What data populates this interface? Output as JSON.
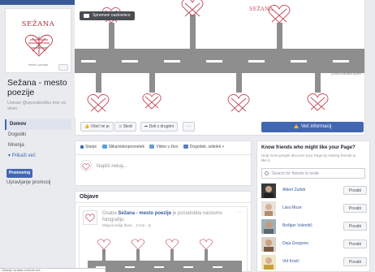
{
  "page": {
    "name": "Sežana - mesto poezije",
    "handle": "Ustvari @uporabniško ime za stran",
    "logo_text": "SEŽANA",
    "logo_sub": "mesto poezije"
  },
  "nav": {
    "items": [
      "Domov",
      "Dogodki",
      "Mnenja"
    ],
    "more": "Prikaži več",
    "promote": "Promoviraj",
    "manage_promos": "Upravljanje promocij"
  },
  "cover": {
    "change_button": "Spremeni naslovnico",
    "top_text": "SEŽANA",
    "credit": "podcrtanka.splet"
  },
  "actions": {
    "like": "Všeč mi je",
    "follow": "Sledi",
    "share": "Deli z drugimi",
    "more": "···",
    "learn_more": "Več informacij"
  },
  "composer": {
    "tabs": [
      "Stanje",
      "Slika/videoposnetek",
      "Video v živo",
      "Dogodek, izdelek +"
    ],
    "placeholder": "Napiši nekaj..."
  },
  "posts": {
    "heading": "Objave",
    "items": [
      {
        "author_prefix": "Osaba ",
        "author_bold": "Sežana - mesto poezije",
        "author_suffix": " je posodobila naslovno fotografijo.",
        "meta": "Objavil Jelija Živec · 2 min · ◎",
        "more": "···"
      }
    ]
  },
  "friends": {
    "title": "Know friends who might like your Page?",
    "subtitle": "Help more people discover your Page by inviting friends to like it.",
    "search_placeholder": "Search for friends to invite",
    "invite_label": "Povabi",
    "list": [
      {
        "name": "Albert Zudek"
      },
      {
        "name": "Lara Moze"
      },
      {
        "name": "Boštjan Volenšič"
      },
      {
        "name": "Deja Gregorec"
      },
      {
        "name": "Vid Kosič"
      }
    ]
  },
  "status_bar": "Čakanje na static.xx.fbcdn.net...",
  "colors": {
    "facebook_blue": "#4267b2",
    "brand_red": "#b02b3a",
    "road_gray": "#8e8e8e"
  }
}
